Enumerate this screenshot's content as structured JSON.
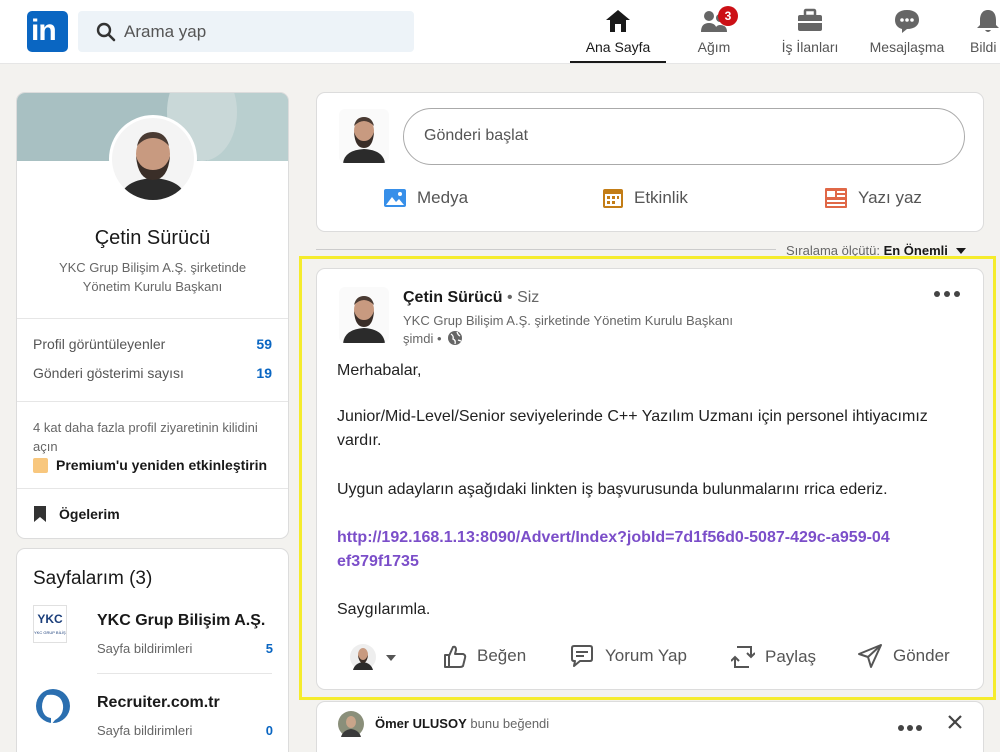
{
  "header": {
    "logo_text": "in",
    "search_placeholder": "Arama yap",
    "nav": [
      {
        "label": "Ana Sayfa",
        "icon": "home-icon"
      },
      {
        "label": "Ağım",
        "icon": "network-icon",
        "badge": "3"
      },
      {
        "label": "İş İlanları",
        "icon": "briefcase-icon"
      },
      {
        "label": "Mesajlaşma",
        "icon": "chat-icon"
      },
      {
        "label": "Bildi",
        "icon": "bell-icon"
      }
    ]
  },
  "profile": {
    "name": "Çetin Sürücü",
    "headline": "YKC Grup Bilişim A.Ş. şirketinde Yönetim Kurulu Başkanı",
    "stats": [
      {
        "label": "Profil görüntüleyenler",
        "value": "59"
      },
      {
        "label": "Gönderi gösterimi sayısı",
        "value": "19"
      }
    ],
    "premium_prompt": "4 kat daha fazla profil ziyaretinin kilidini açın",
    "premium_link": "Premium'u yeniden etkinleştirin",
    "saved_items": "Ögelerim"
  },
  "pages": {
    "title": "Sayfalarım (3)",
    "items": [
      {
        "name": "YKC Grup Bilişim A.Ş.",
        "sub": "Sayfa bildirimleri",
        "count": "5",
        "logo_text": "YKC",
        "logo_sub": "YKC GRUP BİLİŞİM"
      },
      {
        "name": "Recruiter.com.tr",
        "sub": "Sayfa bildirimleri",
        "count": "0"
      }
    ]
  },
  "composer": {
    "placeholder": "Gönderi başlat",
    "actions": [
      {
        "label": "Medya",
        "icon": "image-icon",
        "color": "#378fe9"
      },
      {
        "label": "Etkinlik",
        "icon": "calendar-icon",
        "color": "#c37d16"
      },
      {
        "label": "Yazı yaz",
        "icon": "article-icon",
        "color": "#e06847"
      }
    ]
  },
  "sort": {
    "label": "Sıralama ölçütü:",
    "value": "En Önemli"
  },
  "post": {
    "author": "Çetin Sürücü",
    "self_tag": "• Siz",
    "headline": "YKC Grup Bilişim A.Ş. şirketinde Yönetim Kurulu Başkanı",
    "time": "şimdi •",
    "greeting": "Merhabalar,",
    "body1": "Junior/Mid-Level/Senior seviyelerinde C++ Yazılım Uzmanı için personel ihtiyacımız vardır.",
    "body2": "Uygun adayların aşağıdaki linkten iş başvurusunda bulunmalarını rrica ederiz.",
    "link": "http://192.168.1.13:8090/Advert/Index?jobId=7d1f56d0-5087-429c-a959-04ef379f1735",
    "closing": "Saygılarımla.",
    "actions": [
      {
        "label": "Beğen",
        "icon": "like-icon"
      },
      {
        "label": "Yorum Yap",
        "icon": "comment-icon"
      },
      {
        "label": "Paylaş",
        "icon": "repost-icon"
      },
      {
        "label": "Gönder",
        "icon": "send-icon"
      }
    ]
  },
  "next_post": {
    "user": "Ömer ULUSOY",
    "activity": "bunu beğendi"
  },
  "colors": {
    "brand": "#0a66c2",
    "highlight": "#f5ec2c",
    "link": "#7b4ec9",
    "badge": "#cc1016"
  }
}
